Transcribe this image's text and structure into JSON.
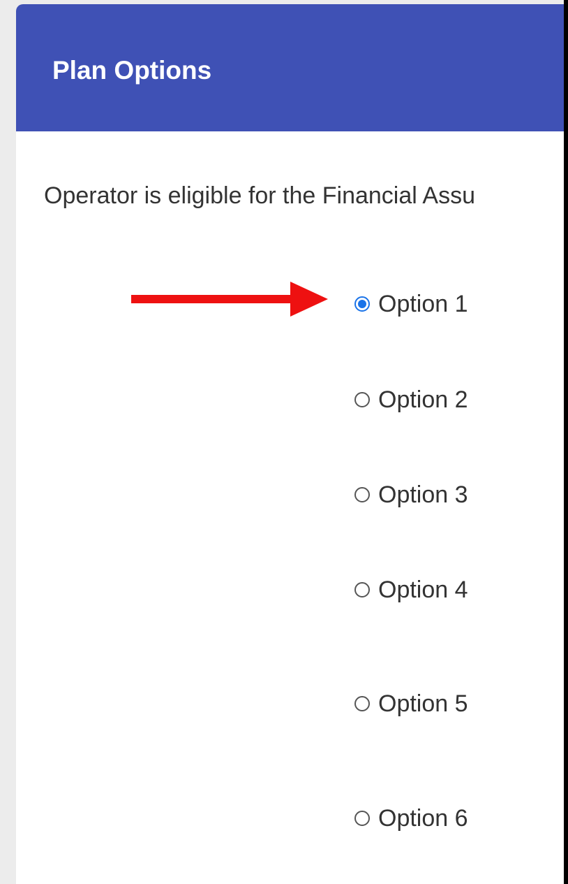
{
  "panel": {
    "title": "Plan Options",
    "description": "Operator is eligible for the Financial Assu"
  },
  "options": [
    {
      "label": "Option 1",
      "checked": true
    },
    {
      "label": "Option 2",
      "checked": false
    },
    {
      "label": "Option 3",
      "checked": false
    },
    {
      "label": "Option 4",
      "checked": false
    },
    {
      "label": "Option 5",
      "checked": false
    },
    {
      "label": "Option 6",
      "checked": false
    }
  ],
  "colors": {
    "header": "#3f51b5",
    "radio_selected": "#1a73e8",
    "arrow": "#ee1111"
  },
  "icons": {
    "annotation": "arrow-right-icon"
  }
}
